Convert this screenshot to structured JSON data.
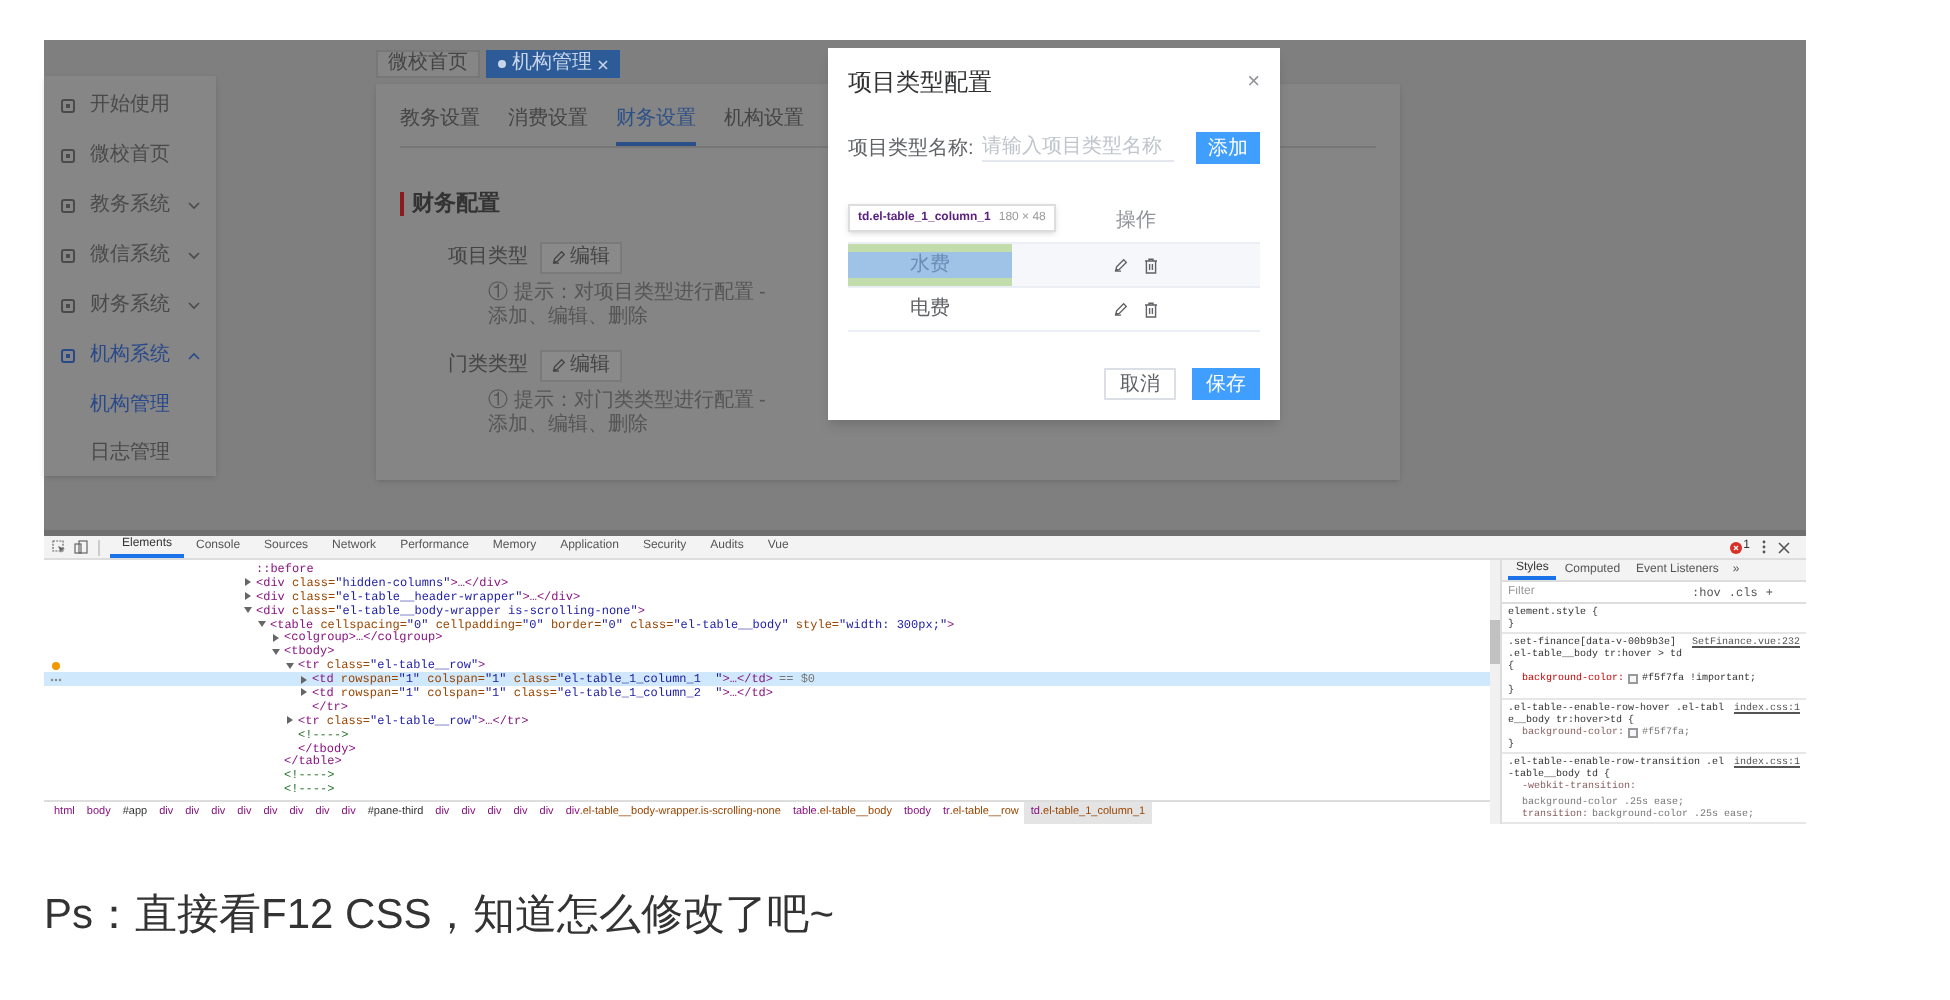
{
  "app": {
    "top_tabs": [
      {
        "label": "微校首页",
        "selected": false,
        "closable": false
      },
      {
        "label": "机构管理",
        "selected": true,
        "closable": true
      }
    ],
    "sidebar": {
      "items": [
        {
          "label": "开始使用",
          "selected": false
        },
        {
          "label": "微校首页",
          "selected": false
        },
        {
          "label": "教务系统",
          "selected": false,
          "expanded": false
        },
        {
          "label": "微信系统",
          "selected": false,
          "expanded": false
        },
        {
          "label": "财务系统",
          "selected": false,
          "expanded": false
        },
        {
          "label": "机构系统",
          "selected": true,
          "expanded": true,
          "children": [
            {
              "label": "机构管理",
              "selected": true
            },
            {
              "label": "日志管理",
              "selected": false
            }
          ]
        }
      ]
    },
    "content_tabs": [
      {
        "label": "教务设置",
        "selected": false
      },
      {
        "label": "消费设置",
        "selected": false
      },
      {
        "label": "财务设置",
        "selected": true
      },
      {
        "label": "机构设置",
        "selected": false
      }
    ],
    "section_title": "财务配置",
    "settings": [
      {
        "label": "项目类型",
        "button": "编辑",
        "hint": "① 提示：对项目类型进行配置 - 添加、编辑、删除"
      },
      {
        "label": "门类类型",
        "button": "编辑",
        "hint": "① 提示：对门类类型进行配置 - 添加、编辑、删除"
      }
    ],
    "dialog": {
      "title": "项目类型配置",
      "close": "×",
      "field_label": "项目类型名称:",
      "placeholder": "请输入项目类型名称",
      "add_button": "添加",
      "header": "操作",
      "rows": [
        {
          "name": "水费",
          "highlighted": true
        },
        {
          "name": "电费",
          "highlighted": false
        }
      ],
      "tooltip": {
        "selector": "td.el-table_1_column_1",
        "size": "180 × 48"
      },
      "cancel": "取消",
      "save": "保存"
    }
  },
  "devtools": {
    "tabs": [
      {
        "label": "Elements",
        "selected": true
      },
      {
        "label": "Console",
        "selected": false
      },
      {
        "label": "Sources",
        "selected": false
      },
      {
        "label": "Network",
        "selected": false
      },
      {
        "label": "Performance",
        "selected": false
      },
      {
        "label": "Memory",
        "selected": false
      },
      {
        "label": "Application",
        "selected": false
      },
      {
        "label": "Security",
        "selected": false
      },
      {
        "label": "Audits",
        "selected": false
      },
      {
        "label": "Vue",
        "selected": false
      }
    ],
    "error_count": "1",
    "tree": [
      {
        "text": "::before",
        "selected": false
      },
      {
        "text": "<div class=\"hidden-columns\">…</div>",
        "expanded": false,
        "selected": false
      },
      {
        "text": "<div class=\"el-table__header-wrapper\">…</div>",
        "expanded": false,
        "selected": false
      },
      {
        "text": "<div class=\"el-table__body-wrapper is-scrolling-none\">",
        "expanded": true,
        "selected": false,
        "children": [
          {
            "text": "<table cellspacing=\"0\" cellpadding=\"0\" border=\"0\" class=\"el-table__body\" style=\"width: 300px;\">",
            "expanded": true,
            "selected": false,
            "children": [
              {
                "text": "<colgroup>…</colgroup>",
                "expanded": false,
                "selected": false
              },
              {
                "text": "<tbody>",
                "expanded": true,
                "selected": false,
                "children": [
                  {
                    "text": "<tr class=\"el-table__row\">",
                    "expanded": true,
                    "selected": false,
                    "marker": true,
                    "children": [
                      {
                        "text": "<td rowspan=\"1\" colspan=\"1\" class=\"el-table_1_column_1  \">…</td>",
                        "expanded": false,
                        "selected": true,
                        "suffix": "== $0"
                      },
                      {
                        "text": "<td rowspan=\"1\" colspan=\"1\" class=\"el-table_1_column_2  \">…</td>",
                        "expanded": false,
                        "selected": false
                      },
                      {
                        "text": "</tr>",
                        "selected": false
                      }
                    ]
                  },
                  {
                    "text": "<tr class=\"el-table__row\">…</tr>",
                    "expanded": false,
                    "selected": false
                  },
                  {
                    "text": "<!---->",
                    "selected": false
                  },
                  {
                    "text": "</tbody>",
                    "selected": false
                  }
                ]
              },
              {
                "text": "</table>",
                "selected": false
              },
              {
                "text": "<!---->",
                "selected": false
              },
              {
                "text": "<!---->",
                "selected": false
              }
            ]
          }
        ]
      }
    ],
    "breadcrumb": [
      {
        "label": "html",
        "selected": false
      },
      {
        "label": "body",
        "selected": false
      },
      {
        "label": "#app",
        "selected": false
      },
      {
        "label": "div",
        "selected": false
      },
      {
        "label": "div",
        "selected": false
      },
      {
        "label": "div",
        "selected": false
      },
      {
        "label": "div",
        "selected": false
      },
      {
        "label": "div",
        "selected": false
      },
      {
        "label": "div",
        "selected": false
      },
      {
        "label": "div",
        "selected": false
      },
      {
        "label": "div",
        "selected": false
      },
      {
        "label": "#pane-third",
        "selected": false
      },
      {
        "label": "div",
        "selected": false
      },
      {
        "label": "div",
        "selected": false
      },
      {
        "label": "div",
        "selected": false
      },
      {
        "label": "div",
        "selected": false
      },
      {
        "label": "div",
        "selected": false
      },
      {
        "label": "div.el-table__body-wrapper.is-scrolling-none",
        "selected": false
      },
      {
        "label": "table.el-table__body",
        "selected": false
      },
      {
        "label": "tbody",
        "selected": false
      },
      {
        "label": "tr.el-table__row",
        "selected": false
      },
      {
        "label": "td.el-table_1_column_1",
        "selected": true
      }
    ],
    "styles": {
      "tabs": [
        {
          "label": "Styles",
          "selected": true
        },
        {
          "label": "Computed",
          "selected": false
        },
        {
          "label": "Event Listeners",
          "selected": false
        }
      ],
      "more": "»",
      "filter_placeholder": "Filter",
      "buttons": [
        ":hov",
        ".cls",
        "+"
      ],
      "rules": [
        {
          "selector": "element.style {",
          "close": "}"
        },
        {
          "selector": ".set-finance[data-v-00b9b3e] .el-table__body tr:hover > td {",
          "source": "SetFinance.vue:232",
          "declarations": [
            {
              "property": "background-color:",
              "value": "#f5f7fa !important;",
              "color": "#f5f7fa",
              "overridden": false
            }
          ],
          "close": "}"
        },
        {
          "selector": ".el-table--enable-row-hover .el-table__body tr:hover>td {",
          "source": "index.css:1",
          "declarations": [
            {
              "property": "background-color:",
              "value": "#f5f7fa;",
              "color": "#f5f7fa",
              "overridden": true
            }
          ],
          "close": "}"
        },
        {
          "selector": ".el-table--enable-row-transition .el-table__body td {",
          "source": "index.css:1",
          "declarations": [
            {
              "property": "-webkit-transition:",
              "value": "background-color .25s ease;",
              "overridden": true
            },
            {
              "property": "transition:",
              "value": "background-color .25s ease;",
              "overridden": true
            }
          ]
        }
      ]
    }
  },
  "caption": "Ps：直接看F12 CSS，知道怎么修改了吧~"
}
